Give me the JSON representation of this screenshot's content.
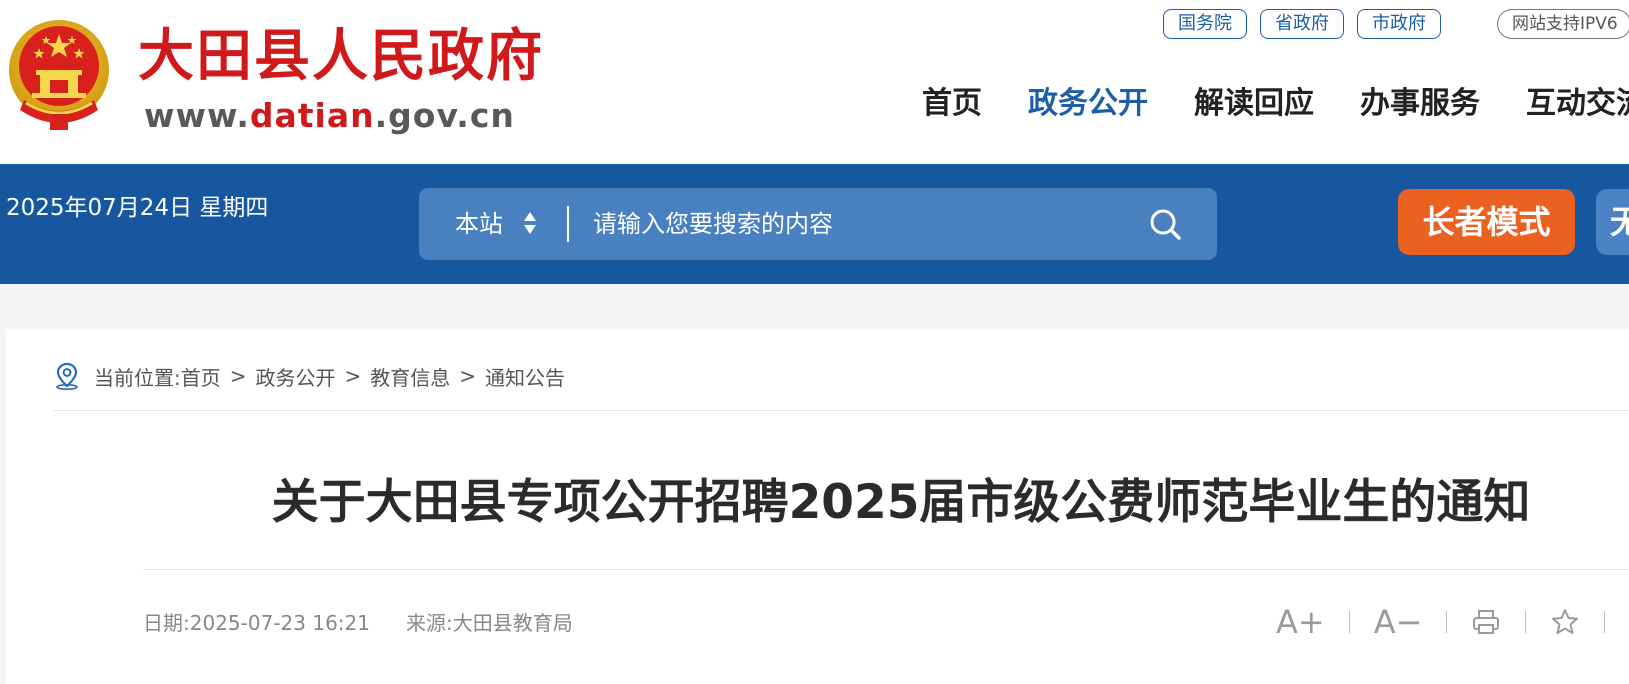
{
  "header": {
    "site_name": "大田县人民政府",
    "site_url_prefix": "www.",
    "site_url_highlight": "datian",
    "site_url_suffix": ".gov.cn",
    "gov_links": [
      {
        "label": "国务院"
      },
      {
        "label": "省政府"
      },
      {
        "label": "市政府"
      }
    ],
    "ipv6_label": "网站支持IPV6",
    "nav": [
      {
        "label": "首页",
        "active": false
      },
      {
        "label": "政务公开",
        "active": true
      },
      {
        "label": "解读回应",
        "active": false
      },
      {
        "label": "办事服务",
        "active": false
      },
      {
        "label": "互动交流",
        "active": false
      }
    ]
  },
  "topbar": {
    "date": "2025年07月24日 星期四",
    "search_scope": "本站",
    "search_placeholder": "请输入您要搜索的内容",
    "elder_mode_label": "长者模式",
    "accessibility_label": "无"
  },
  "breadcrumb": {
    "label": "当前位置:",
    "items": [
      "首页",
      "政务公开",
      "教育信息",
      "通知公告"
    ],
    "separator": ">"
  },
  "article": {
    "title": "关于大田县专项公开招聘2025届市级公费师范毕业生的通知",
    "date_label": "日期:",
    "date_value": "2025-07-23 16:21",
    "source_label": "来源:",
    "source_value": "大田县教育局",
    "tools": {
      "increase_font": "A+",
      "decrease_font": "A−"
    }
  },
  "colors": {
    "brand_red": "#d0191b",
    "brand_blue": "#1757a0",
    "active_nav": "#1c5ea7",
    "elder_orange": "#ea6120"
  },
  "icons": [
    "national-emblem-icon",
    "sort-arrows-icon",
    "search-icon",
    "location-pin-icon",
    "print-icon",
    "star-icon"
  ]
}
